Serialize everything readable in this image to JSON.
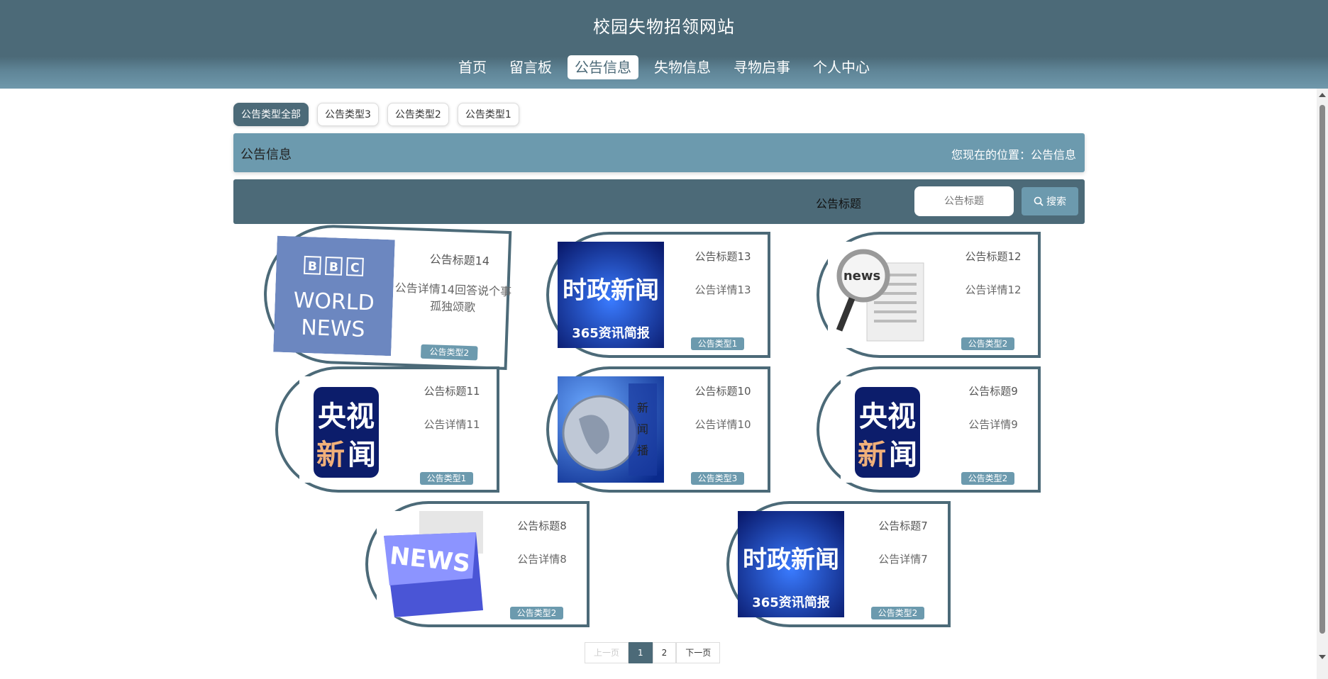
{
  "header": {
    "site_title": "校园失物招领网站",
    "nav": [
      "首页",
      "留言板",
      "公告信息",
      "失物信息",
      "寻物启事",
      "个人中心"
    ],
    "active_nav_index": 2
  },
  "type_tabs": [
    "公告类型全部",
    "公告类型3",
    "公告类型2",
    "公告类型1"
  ],
  "breadcrumb": {
    "title": "公告信息",
    "location": "您现在的位置：公告信息"
  },
  "search": {
    "label": "公告标题",
    "placeholder": "公告标题",
    "button": "搜索"
  },
  "cards": [
    {
      "title": "公告标题14",
      "desc": "公告详情14回答说个事孤独颂歌",
      "type": "公告类型2",
      "image": "BBC WORLD NEWS"
    },
    {
      "title": "公告标题13",
      "desc": "公告详情13",
      "type": "公告类型1",
      "image": "时政新闻 365资讯简报"
    },
    {
      "title": "公告标题12",
      "desc": "公告详情12",
      "type": "公告类型2",
      "image": "news"
    },
    {
      "title": "公告标题11",
      "desc": "公告详情11",
      "type": "公告类型1",
      "image": "央视新闻"
    },
    {
      "title": "公告标题10",
      "desc": "公告详情10",
      "type": "公告类型3",
      "image": "globe"
    },
    {
      "title": "公告标题9",
      "desc": "公告详情9",
      "type": "公告类型2",
      "image": "央视新闻"
    },
    {
      "title": "公告标题8",
      "desc": "公告详情8",
      "type": "公告类型2",
      "image": "NEWS"
    },
    {
      "title": "公告标题7",
      "desc": "公告详情7",
      "type": "公告类型2",
      "image": "时政新闻 365资讯简报"
    }
  ],
  "pager": {
    "prev": "上一页",
    "pages": [
      "1",
      "2"
    ],
    "next": "下一页",
    "current": "1"
  },
  "colors": {
    "primary": "#4c6a78",
    "accent": "#6c9aae"
  }
}
